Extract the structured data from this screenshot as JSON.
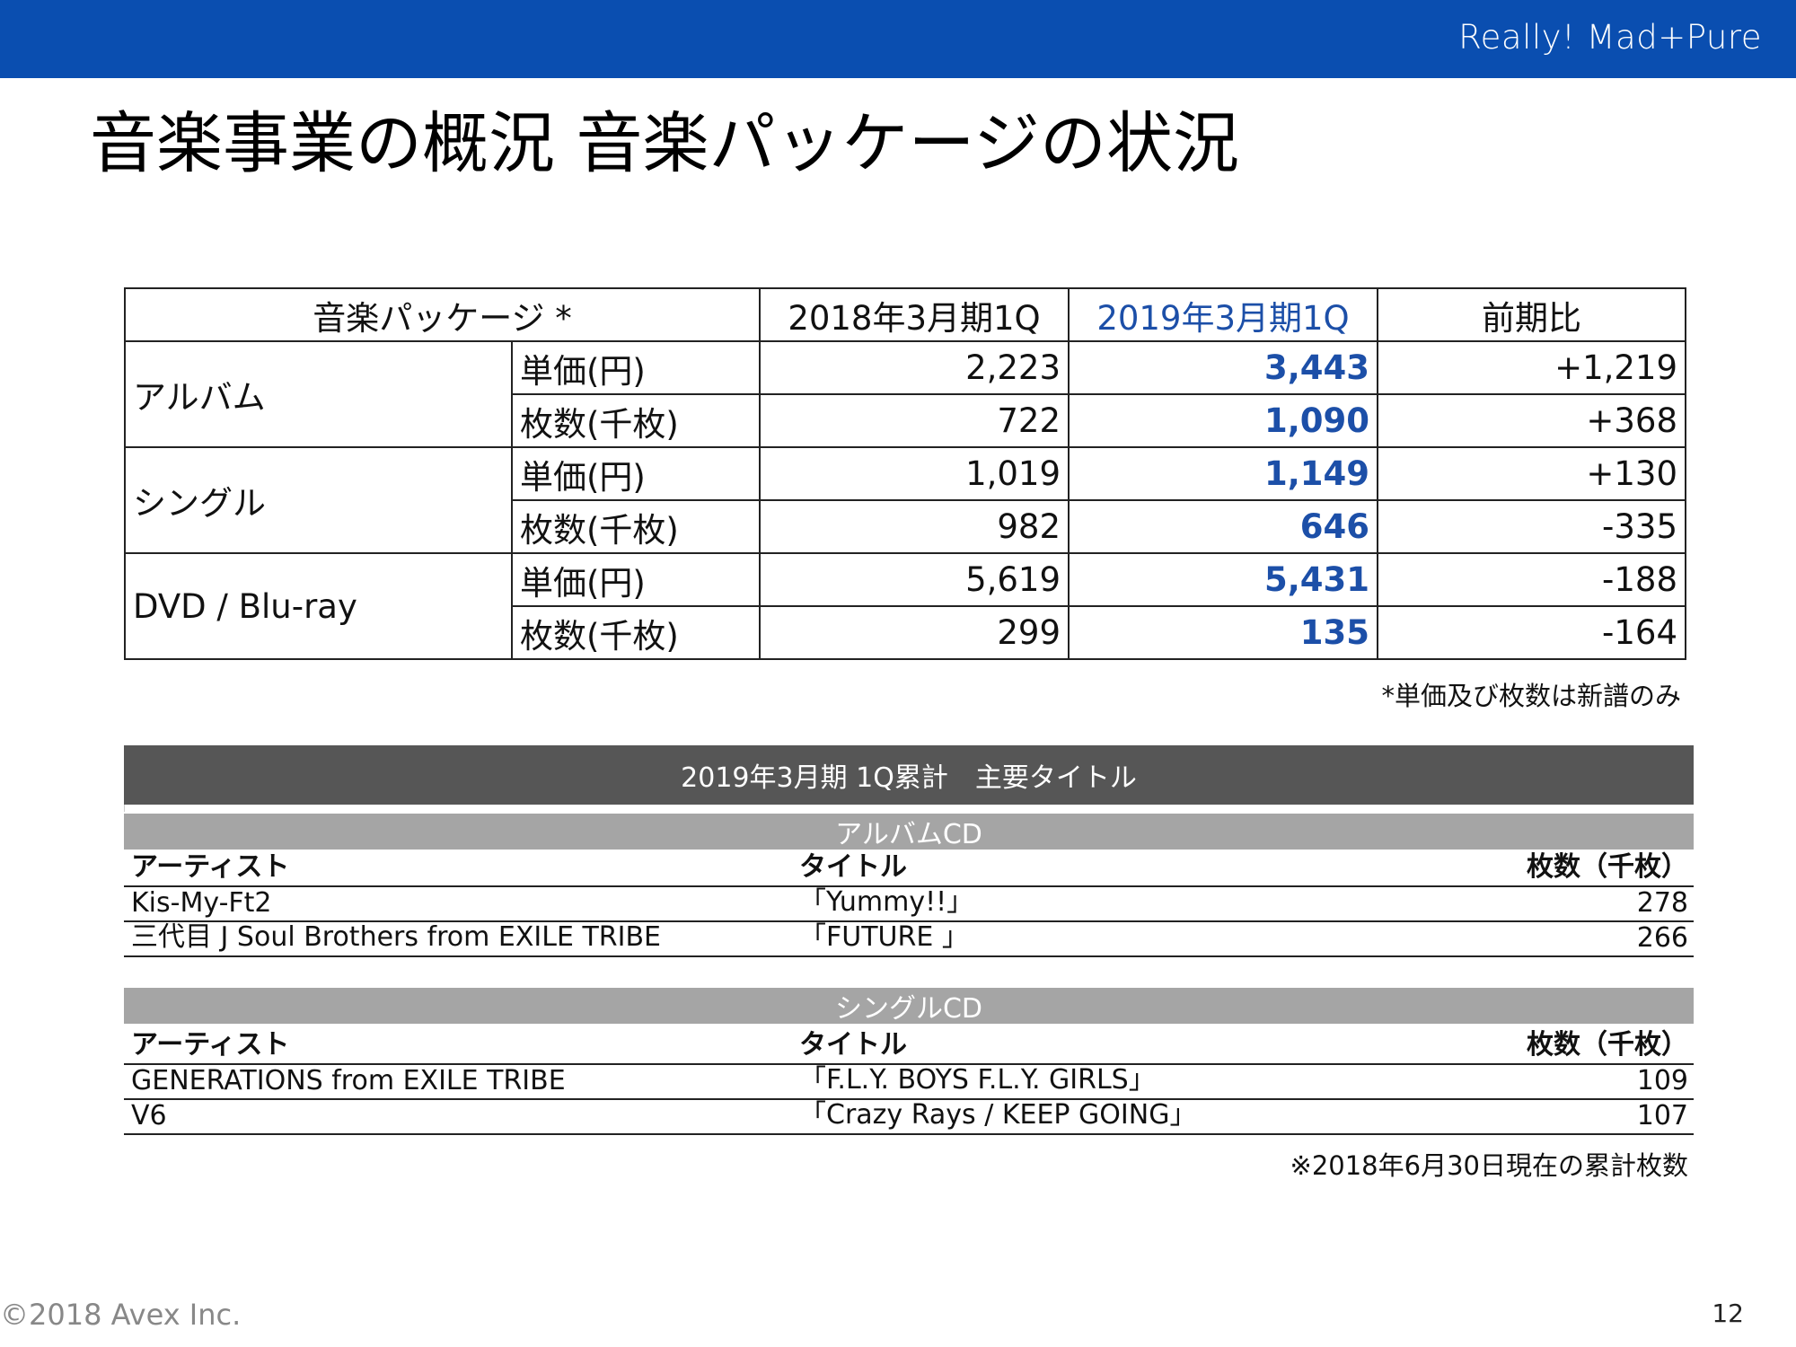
{
  "header": {
    "brand": "Really! Mad+Pure"
  },
  "page_title": "音楽事業の概況  音楽パッケージの状況",
  "package_table": {
    "headers": [
      "音楽パッケージ *",
      "2018年3月期1Q",
      "2019年3月期1Q",
      "前期比"
    ],
    "categories": [
      {
        "name": "アルバム",
        "rows": [
          {
            "metric": "単価(円)",
            "prev": "2,223",
            "curr": "3,443",
            "diff": "+1,219"
          },
          {
            "metric": "枚数(千枚)",
            "prev": "722",
            "curr": "1,090",
            "diff": "+368"
          }
        ]
      },
      {
        "name": "シングル",
        "rows": [
          {
            "metric": "単価(円)",
            "prev": "1,019",
            "curr": "1,149",
            "diff": "+130"
          },
          {
            "metric": "枚数(千枚)",
            "prev": "982",
            "curr": "646",
            "diff": "-335"
          }
        ]
      },
      {
        "name": "DVD / Blu-ray",
        "rows": [
          {
            "metric": "単価(円)",
            "prev": "5,619",
            "curr": "5,431",
            "diff": "-188"
          },
          {
            "metric": "枚数(千枚)",
            "prev": "299",
            "curr": "135",
            "diff": "-164"
          }
        ]
      }
    ],
    "note": "*単価及び枚数は新譜のみ"
  },
  "titles": {
    "heading": "2019年3月期 1Q累計　主要タイトル",
    "columns": {
      "artist": "アーティスト",
      "title": "タイトル",
      "count": "枚数（千枚）"
    },
    "album": {
      "label": "アルバムCD",
      "rows": [
        {
          "artist": "Kis-My-Ft2",
          "title": "「Yummy!!」",
          "count": "278"
        },
        {
          "artist": "三代目 J Soul Brothers from EXILE TRIBE",
          "title": "「FUTURE 」",
          "count": "266"
        }
      ]
    },
    "single": {
      "label": "シングルCD",
      "rows": [
        {
          "artist": "GENERATIONS from EXILE TRIBE",
          "title": "「F.L.Y. BOYS F.L.Y. GIRLS」",
          "count": "109"
        },
        {
          "artist": "V6",
          "title": "「Crazy Rays / KEEP GOING」",
          "count": "107"
        }
      ]
    },
    "note": "※2018年6月30日現在の累計枚数"
  },
  "footer": {
    "copyright": "©2018 Avex Inc.",
    "page": "12"
  },
  "colors": {
    "header_bar": "#0a4eb0",
    "highlight": "#1c4fa8",
    "dark_band": "#565656",
    "light_band": "#a5a5a5"
  }
}
